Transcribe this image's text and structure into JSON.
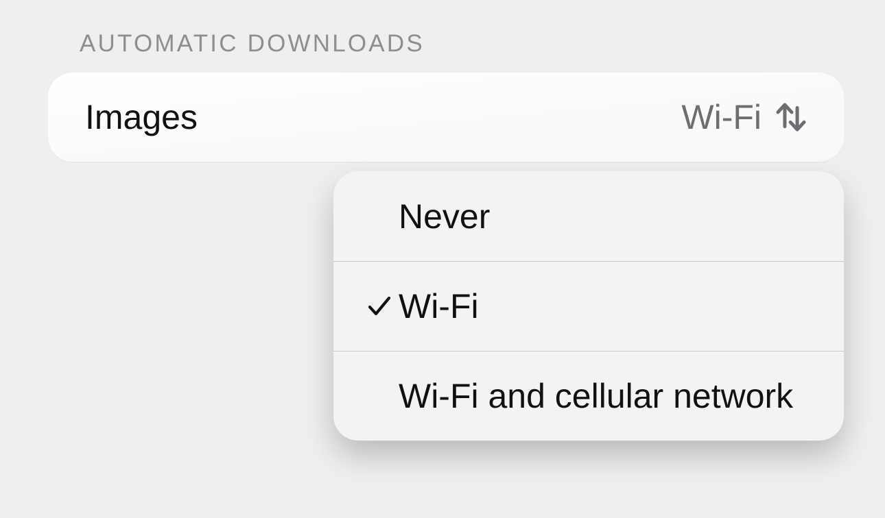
{
  "section": {
    "header": "AUTOMATIC DOWNLOADS"
  },
  "setting": {
    "label": "Images",
    "value": "Wi-Fi"
  },
  "menu": {
    "options": [
      {
        "label": "Never",
        "selected": false
      },
      {
        "label": "Wi-Fi",
        "selected": true
      },
      {
        "label": "Wi-Fi and cellular network",
        "selected": false
      }
    ]
  },
  "colors": {
    "page_bg": "#EFEFF0",
    "card_bg": "#FFFFFF",
    "menu_bg": "#F3F3F4",
    "header_grey": "#8E8E92",
    "value_grey": "#6E6E72",
    "divider": "#C9C9CC",
    "text": "#111111"
  }
}
